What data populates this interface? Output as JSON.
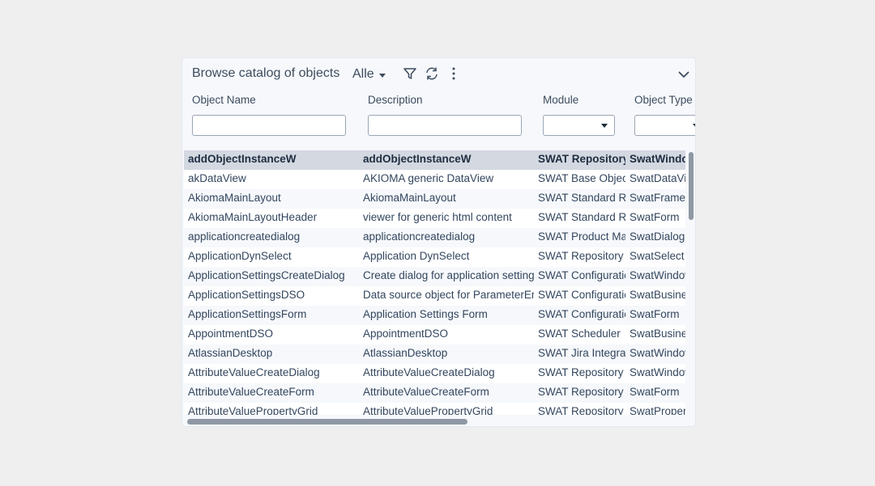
{
  "header": {
    "title": "Browse catalog of objects",
    "filter_value": "Alle",
    "icons": [
      "filter-icon",
      "refresh-icon",
      "more-vertical-icon",
      "chevron-down-icon"
    ]
  },
  "columns": {
    "name": "Object Name",
    "description": "Description",
    "module": "Module",
    "type": "Object Type"
  },
  "filters": {
    "name_value": "",
    "description_value": "",
    "module_value": "",
    "type_value": ""
  },
  "rows": [
    {
      "name": "addObjectInstanceW",
      "description": "addObjectInstanceW",
      "module": "SWAT Repository",
      "type": "SwatWindow",
      "selected": true
    },
    {
      "name": "akDataView",
      "description": "AKIOMA generic DataView",
      "module": "SWAT Base Objects",
      "type": "SwatDataView"
    },
    {
      "name": "AkiomaMainLayout",
      "description": "AkiomaMainLayout",
      "module": "SWAT Standard Re",
      "type": "SwatFrame"
    },
    {
      "name": "AkiomaMainLayoutHeader",
      "description": "viewer for generic html content",
      "module": "SWAT Standard Re",
      "type": "SwatForm"
    },
    {
      "name": "applicationcreatedialog",
      "description": "applicationcreatedialog",
      "module": "SWAT Product Ma",
      "type": "SwatDialog"
    },
    {
      "name": "ApplicationDynSelect",
      "description": "Application DynSelect",
      "module": "SWAT Repository I",
      "type": "SwatSelect"
    },
    {
      "name": "ApplicationSettingsCreateDialog",
      "description": "Create dialog for application settings",
      "module": "SWAT Configuratic",
      "type": "SwatWindow"
    },
    {
      "name": "ApplicationSettingsDSO",
      "description": "Data source object for ParameterEn",
      "module": "SWAT Configuratic",
      "type": "SwatBusiness"
    },
    {
      "name": "ApplicationSettingsForm",
      "description": "Application Settings Form",
      "module": "SWAT Configuratic",
      "type": "SwatForm"
    },
    {
      "name": "AppointmentDSO",
      "description": "AppointmentDSO",
      "module": "SWAT Scheduler",
      "type": "SwatBusiness"
    },
    {
      "name": "AtlassianDesktop",
      "description": "AtlassianDesktop",
      "module": "SWAT Jira Integrat",
      "type": "SwatWindow"
    },
    {
      "name": "AttributeValueCreateDialog",
      "description": "AttributeValueCreateDialog",
      "module": "SWAT Repository I",
      "type": "SwatWindow"
    },
    {
      "name": "AttributeValueCreateForm",
      "description": "AttributeValueCreateForm",
      "module": "SWAT Repository I",
      "type": "SwatForm"
    },
    {
      "name": "AttributeValuePropertyGrid",
      "description": "AttributeValuePropertyGrid",
      "module": "SWAT Repository I",
      "type": "SwatProperty"
    }
  ]
}
